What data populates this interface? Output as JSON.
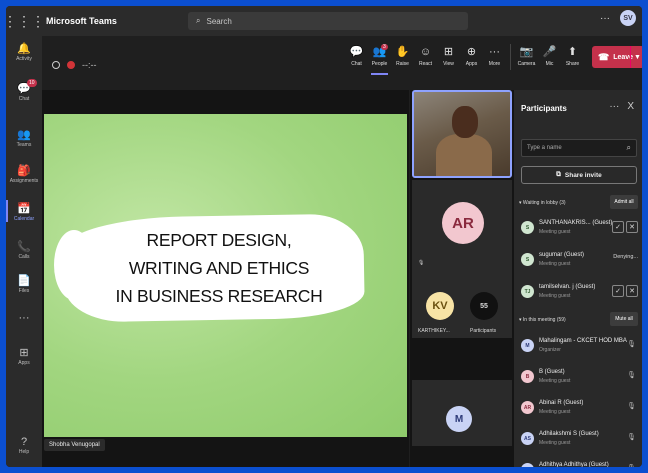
{
  "window": {
    "app_title": "Microsoft Teams",
    "search_placeholder": "Search",
    "more": "···",
    "avatar": "SV"
  },
  "rail": [
    {
      "icon": "bell-icon",
      "glyph": "🔔",
      "label": "Activity"
    },
    {
      "icon": "chat-icon",
      "glyph": "💬",
      "label": "Chat",
      "badge": "10"
    },
    {
      "icon": "teams-icon",
      "glyph": "👥",
      "label": "Teams"
    },
    {
      "icon": "assignments-icon",
      "glyph": "🎒",
      "label": "Assignments"
    },
    {
      "icon": "calendar-icon",
      "glyph": "📅",
      "label": "Calendar",
      "active": true
    },
    {
      "icon": "calls-icon",
      "glyph": "📞",
      "label": "Calls"
    },
    {
      "icon": "files-icon",
      "glyph": "📄",
      "label": "Files"
    },
    {
      "icon": "more-icon",
      "glyph": "···",
      "label": ""
    },
    {
      "icon": "apps-icon",
      "glyph": "⊞",
      "label": "Apps"
    },
    {
      "icon": "help-icon",
      "glyph": "?",
      "label": "Help"
    }
  ],
  "call": {
    "timer": "--:--"
  },
  "toolbar": {
    "tools": [
      {
        "icon": "chat-icon",
        "glyph": "💬",
        "label": "Chat"
      },
      {
        "icon": "people-icon",
        "glyph": "👥",
        "label": "People",
        "badge": "3",
        "selected": true
      },
      {
        "icon": "raise-hand-icon",
        "glyph": "✋",
        "label": "Raise"
      },
      {
        "icon": "react-icon",
        "glyph": "☺",
        "label": "React"
      },
      {
        "icon": "view-icon",
        "glyph": "⊞",
        "label": "View"
      },
      {
        "icon": "apps-icon",
        "glyph": "⊕",
        "label": "Apps"
      },
      {
        "icon": "more-icon",
        "glyph": "···",
        "label": "More"
      }
    ],
    "devices": [
      {
        "icon": "camera-off-icon",
        "glyph": "📷",
        "label": "Camera"
      },
      {
        "icon": "mic-off-icon",
        "glyph": "🎤",
        "label": "Mic"
      },
      {
        "icon": "share-icon",
        "glyph": "⬆",
        "label": "Share"
      }
    ],
    "leave_label": "Leave"
  },
  "slide": {
    "lines": [
      "REPORT DESIGN,",
      "WRITING AND ETHICS",
      "IN BUSINESS RESEARCH"
    ],
    "presenter": "Shobha Venugopal"
  },
  "gallery": {
    "ar_initials": "AR",
    "kv_initials": "KV",
    "kv_label": "KARTHIKEY...",
    "participant_count": "55",
    "participants_label": "Participants",
    "m_initials": "M"
  },
  "panel": {
    "title": "Participants",
    "more": "···",
    "close": "X",
    "search_placeholder": "Type a name",
    "share_invite": "Share invite",
    "lobby_header": "Waiting in lobby (3)",
    "admit_all": "Admit all",
    "lobby": [
      {
        "initials": "S",
        "name": "SANTHANAKRIS... (Guest)",
        "role": "Meeting guest",
        "action": "buttons"
      },
      {
        "initials": "S",
        "name": "sugumar (Guest)",
        "role": "Meeting guest",
        "action": "Denying..."
      },
      {
        "initials": "TJ",
        "name": "tamilselvan. j (Guest)",
        "role": "Meeting guest",
        "action": "buttons"
      }
    ],
    "meeting_header": "In this meeting (59)",
    "mute_all": "Mute all",
    "members": [
      {
        "initials": "M",
        "name": "Mahalingam - CKCET HOD MBA",
        "role": "Organizer",
        "color": "#c9d3f5",
        "text": "#2d3a78"
      },
      {
        "initials": "B",
        "name": "B (Guest)",
        "role": "Meeting guest",
        "color": "#f2c7cf",
        "text": "#8a2a3e"
      },
      {
        "initials": "AR",
        "name": "Abinai R (Guest)",
        "role": "Meeting guest",
        "color": "#f2c7cf",
        "text": "#8a2a3e"
      },
      {
        "initials": "AS",
        "name": "Adhilakshmi S (Guest)",
        "role": "Meeting guest",
        "color": "#c9d3f5",
        "text": "#2d3a78"
      },
      {
        "initials": "A",
        "name": "Adhithya Adhithya (Guest)",
        "role": "",
        "color": "#c9d3f5",
        "text": "#2d3a78"
      }
    ]
  },
  "colors": {
    "accent": "#7f85f5",
    "leave": "#c4314b",
    "slide_green": "#a9d98a"
  }
}
